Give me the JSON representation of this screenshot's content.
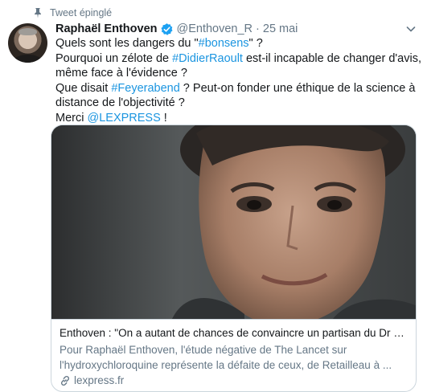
{
  "pinned": {
    "label": "Tweet épinglé",
    "icon": "pin-icon"
  },
  "author": {
    "name": "Raphaël Enthoven",
    "handle": "@Enthoven_R",
    "separator": "·",
    "date": "25 mai",
    "verified": true
  },
  "tweet": {
    "segments": {
      "l1_a": "Quels sont les dangers du \"",
      "l1_tag": "#bonsens",
      "l1_b": "\" ?",
      "l2_a": "Pourquoi un zélote de ",
      "l2_tag": "#DidierRaoult",
      "l2_b": " est-il incapable de changer d'avis,",
      "l3": "même face à l'évidence ?",
      "l4_a": "Que disait ",
      "l4_tag": "#Feyerabend",
      "l4_b": " ? Peut-on fonder une éthique de la science à",
      "l5": "distance de l'objectivité ?",
      "l6_a": "Merci ",
      "l6_mention": "@LEXPRESS",
      "l6_b": " !"
    }
  },
  "card": {
    "image": "portrait-photo",
    "title": "Enthoven : \"On a autant de chances de convaincre un partisan du Dr Ra...",
    "description_line1": "Pour Raphaël Enthoven, l'étude négative de The Lancet sur",
    "description_line2": "l'hydroxychloroquine représente la défaite de ceux, de Retailleau à ...",
    "domain": "lexpress.fr"
  },
  "colors": {
    "text": "#14171a",
    "secondary": "#657786",
    "link": "#1b95e0",
    "border": "#ccd6dd",
    "verified": "#1da1f2"
  }
}
